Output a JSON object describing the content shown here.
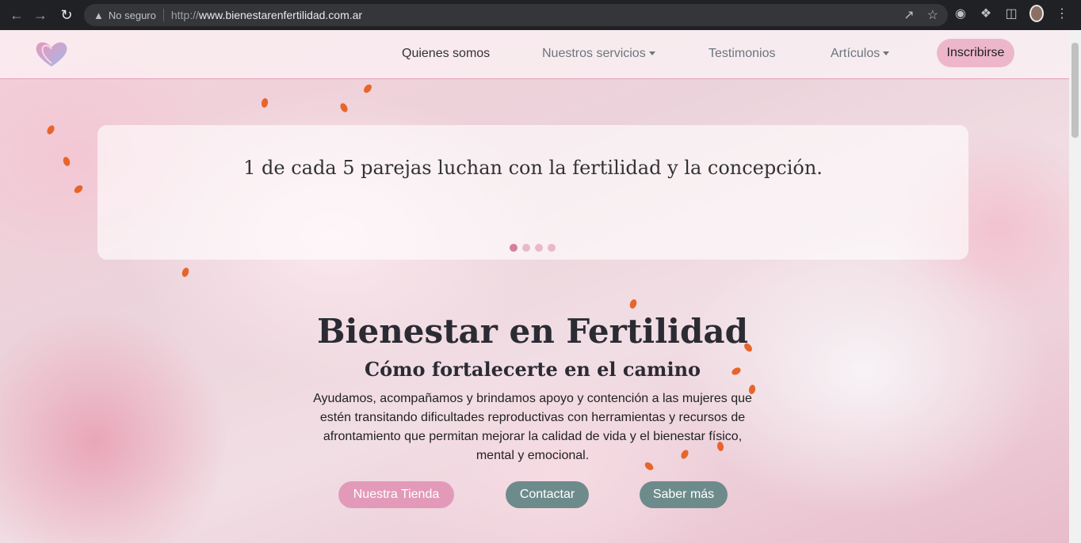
{
  "browser": {
    "security_label": "No seguro",
    "url_prefix": "http://",
    "url_domain": "www.bienestarenfertilidad.com.ar"
  },
  "nav": {
    "items": [
      {
        "label": "Quienes somos",
        "dropdown": false
      },
      {
        "label": "Nuestros servicios",
        "dropdown": true
      },
      {
        "label": "Testimonios",
        "dropdown": false
      },
      {
        "label": "Artículos",
        "dropdown": true
      }
    ],
    "cta_label": "Inscribirse"
  },
  "carousel": {
    "slide_text": "1 de cada 5 parejas luchan con la fertilidad y la concepción.",
    "slide_count": 4,
    "active_index": 0
  },
  "hero": {
    "title": "Bienestar en Fertilidad",
    "subtitle": "Cómo fortalecerte en el camino",
    "description": "Ayudamos, acompañamos y brindamos apoyo y contención a las mujeres que estén transitando dificultades reproductivas con herramientas y recursos de afrontamiento que permitan mejorar la calidad de vida y el bienestar físico, mental y emocional.",
    "buttons": {
      "store": "Nuestra Tienda",
      "contact": "Contactar",
      "more": "Saber más"
    }
  },
  "colors": {
    "accent_pink": "#e39ab9",
    "accent_teal": "#6e8b8c",
    "cta_pink": "#eeb6cb"
  }
}
